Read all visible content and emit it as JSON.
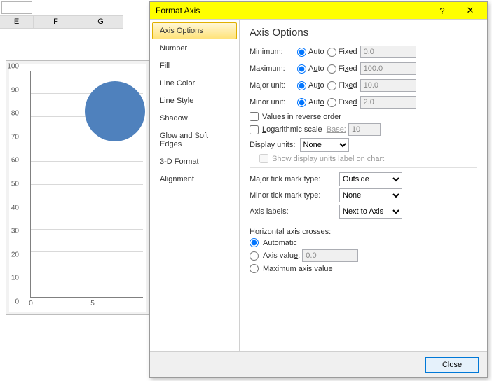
{
  "sheet": {
    "columns": [
      "E",
      "F",
      "G"
    ],
    "chart": {
      "y_ticks": [
        "100",
        "90",
        "80",
        "70",
        "60",
        "50",
        "40",
        "30",
        "20",
        "10",
        "0"
      ],
      "x_ticks": [
        "0",
        "5"
      ]
    }
  },
  "dialog": {
    "title": "Format Axis",
    "help": "?",
    "close_glyph": "✕",
    "nav": {
      "items": [
        "Axis Options",
        "Number",
        "Fill",
        "Line Color",
        "Line Style",
        "Shadow",
        "Glow and Soft Edges",
        "3-D Format",
        "Alignment"
      ],
      "active_index": 0
    },
    "content": {
      "heading": "Axis Options",
      "min_label": "Minimum:",
      "max_label": "Maximum:",
      "major_label": "Major unit:",
      "minor_label": "Minor unit:",
      "auto_label": "Auto",
      "fixed_label": "Fixed",
      "min_val": "0.0",
      "max_val": "100.0",
      "major_val": "10.0",
      "minor_val": "2.0",
      "reverse_label_pre": "V",
      "reverse_label": "alues in reverse order",
      "log_label_pre": "L",
      "log_label": "ogarithmic scale",
      "base_label": "Base:",
      "log_base": "10",
      "display_units_label": "Display units:",
      "display_units_value": "None",
      "show_dul_pre": "S",
      "show_dul": "how display units label on chart",
      "major_tick_label": "Major tick mark type:",
      "major_tick_value": "Outside",
      "minor_tick_label": "Minor tick mark type:",
      "minor_tick_value": "None",
      "axis_labels_label": "Axis labels:",
      "axis_labels_value": "Next to Axis",
      "crosses_heading": "Horizontal axis crosses:",
      "crosses_auto": "Automatic",
      "crosses_value_label": "Axis value:",
      "crosses_value": "0.0",
      "crosses_max": "Maximum axis value",
      "close_button": "Close"
    }
  },
  "chart_data": {
    "type": "scatter",
    "title": "",
    "xlabel": "",
    "ylabel": "",
    "xlim": [
      0,
      10
    ],
    "ylim": [
      0,
      100
    ],
    "y_ticks": [
      0,
      10,
      20,
      30,
      40,
      50,
      60,
      70,
      80,
      90,
      100
    ],
    "x_ticks": [
      0,
      5
    ],
    "series": [
      {
        "name": "",
        "x": [
          8
        ],
        "y": [
          82
        ],
        "size": [
          86
        ]
      }
    ],
    "note": "Single bubble partially clipped by dialog; x≈8 estimated, y≈82 from gridlines."
  }
}
